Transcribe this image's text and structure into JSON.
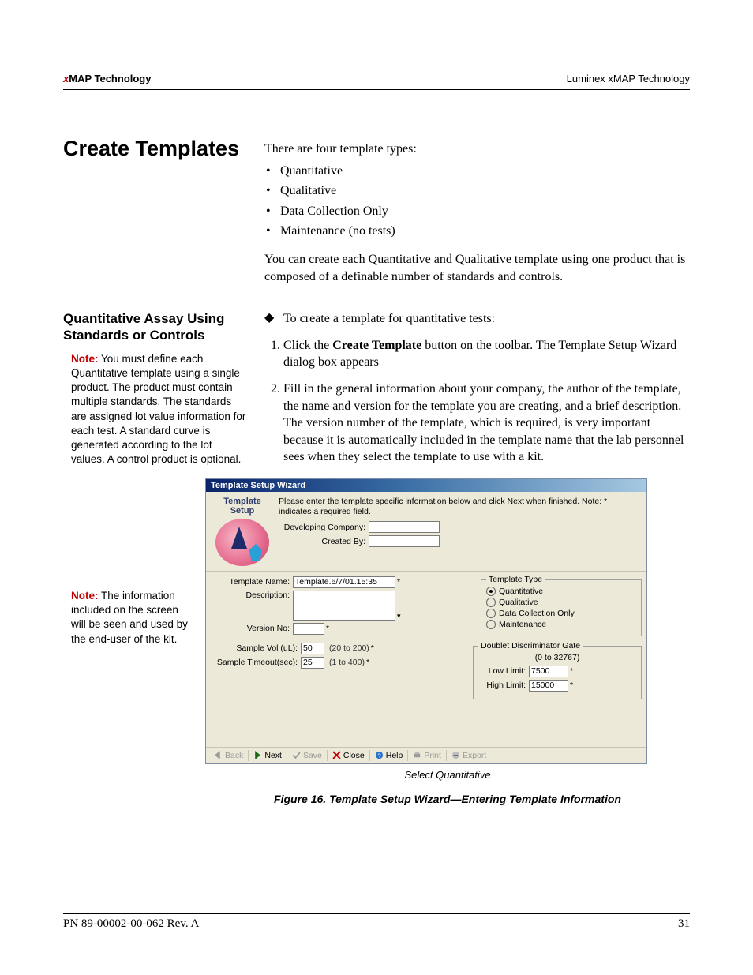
{
  "header": {
    "left_x": "x",
    "left_rest": "MAP Technology",
    "right": "Luminex xMAP Technology"
  },
  "section1": {
    "heading": "Create Templates",
    "intro": "There are four template types:",
    "bullets": [
      "Quantitative",
      "Qualitative",
      "Data Collection Only",
      "Maintenance (no tests)"
    ],
    "para_after": "You can create each Quantitative and Qualitative template using one product that is composed of a definable number of standards and controls."
  },
  "section2": {
    "heading": "Quantitative Assay Using Standards or Controls",
    "note1_label": "Note:",
    "note1_text": " You must define each Quantitative template using a single product. The product must contain multiple standards. The standards are assigned lot value information for each test. A standard curve is generated according to the lot values. A control product is optional.",
    "diamond": "To create a template for quantitative tests:",
    "step1_a": "Click the ",
    "step1_b": "Create Template",
    "step1_c": " button on the toolbar. The Template Setup Wizard dialog box appears",
    "step2": "Fill in the general information about your company, the author of the template, the name and version for the template you are creating, and a brief description. The version number of the template, which is required, is very important because it is automatically included in the template name that the lab personnel sees when they select the template to use with a kit.",
    "note2_label": "Note:",
    "note2_text": " The information included on the screen will be seen and used by the end-user of the kit."
  },
  "wizard": {
    "title": "Template Setup Wizard",
    "side_title": "Template Setup",
    "instructions": "Please enter the template specific information below and click Next when finished.  Note: * indicates a required field.",
    "dev_company_label": "Developing Company:",
    "dev_company_value": "",
    "created_by_label": "Created By:",
    "created_by_value": "",
    "tpl_name_label": "Template Name:",
    "tpl_name_value": "Template.6/7/01.15:35",
    "desc_label": "Description:",
    "desc_value": "",
    "ver_label": "Version No:",
    "ver_value": "",
    "type_legend": "Template Type",
    "type_options": [
      "Quantitative",
      "Qualitative",
      "Data Collection Only",
      "Maintenance"
    ],
    "sample_vol_label": "Sample Vol (uL):",
    "sample_vol_value": "50",
    "sample_vol_hint": "(20 to 200)",
    "sample_timeout_label": "Sample Timeout(sec):",
    "sample_timeout_value": "25",
    "sample_timeout_hint": "(1 to 400)",
    "dd_legend": "Doublet Discriminator Gate",
    "dd_hint": "(0 to 32767)",
    "low_label": "Low Limit:",
    "low_value": "7500",
    "high_label": "High Limit:",
    "high_value": "15000",
    "buttons": {
      "back": "Back",
      "next": "Next",
      "save": "Save",
      "close": "Close",
      "help": "Help",
      "print": "Print",
      "export": "Export"
    }
  },
  "caption_sel": "Select Quantitative",
  "figure_caption": "Figure 16.  Template Setup Wizard—Entering Template Information",
  "footer": {
    "left": "PN 89-00002-00-062 Rev. A",
    "right": "31"
  }
}
